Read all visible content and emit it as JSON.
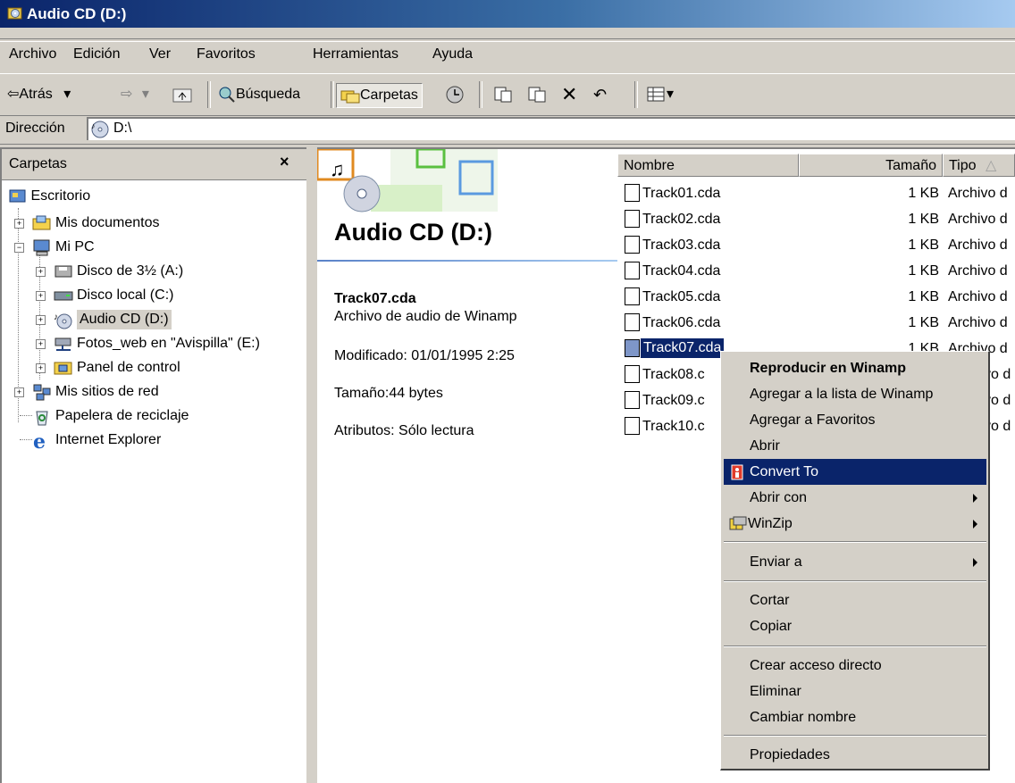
{
  "window": {
    "title": "Audio CD (D:)"
  },
  "menu": [
    "Archivo",
    "Edición",
    "Ver",
    "Favoritos",
    "Herramientas",
    "Ayuda"
  ],
  "toolbar": {
    "back": "Atrás",
    "search": "Búsqueda",
    "folders": "Carpetas"
  },
  "address": {
    "label": "Dirección",
    "value": "D:\\"
  },
  "folders_pane": {
    "title": "Carpetas",
    "items": [
      {
        "label": "Escritorio",
        "icon": "desktop-icon"
      },
      {
        "label": "Mis documentos",
        "icon": "documents-folder-icon"
      },
      {
        "label": "Mi PC",
        "icon": "computer-icon"
      },
      {
        "label": "Disco de 3½ (A:)",
        "icon": "floppy-icon"
      },
      {
        "label": "Disco local (C:)",
        "icon": "hard-drive-icon"
      },
      {
        "label": "Audio CD (D:)",
        "icon": "audio-cd-icon"
      },
      {
        "label": "Fotos_web en \"Avispilla\" (E:)",
        "icon": "network-drive-icon"
      },
      {
        "label": "Panel de control",
        "icon": "control-panel-icon"
      },
      {
        "label": "Mis sitios de red",
        "icon": "network-places-icon"
      },
      {
        "label": "Papelera de reciclaje",
        "icon": "recycle-bin-icon"
      },
      {
        "label": "Internet Explorer",
        "icon": "internet-explorer-icon"
      }
    ]
  },
  "details": {
    "title": "Audio CD (D:)",
    "file_name": "Track07.cda",
    "file_type": "Archivo de audio de Winamp",
    "modified": "Modificado: 01/01/1995 2:25",
    "size": "Tamaño:44 bytes",
    "attributes": "Atributos: Sólo lectura"
  },
  "list": {
    "columns": [
      "Nombre",
      "Tamaño",
      "Tipo"
    ],
    "rows": [
      {
        "name": "Track01.cda",
        "size": "1 KB",
        "type": "Archivo d"
      },
      {
        "name": "Track02.cda",
        "size": "1 KB",
        "type": "Archivo d"
      },
      {
        "name": "Track03.cda",
        "size": "1 KB",
        "type": "Archivo d"
      },
      {
        "name": "Track04.cda",
        "size": "1 KB",
        "type": "Archivo d"
      },
      {
        "name": "Track05.cda",
        "size": "1 KB",
        "type": "Archivo d"
      },
      {
        "name": "Track06.cda",
        "size": "1 KB",
        "type": "Archivo d"
      },
      {
        "name": "Track07.cda",
        "size": "1 KB",
        "type": "Archivo d"
      },
      {
        "name": "Track08.c",
        "size": "",
        "type": "vo d"
      },
      {
        "name": "Track09.c",
        "size": "",
        "type": "vo d"
      },
      {
        "name": "Track10.c",
        "size": "",
        "type": "vo d"
      }
    ]
  },
  "context_menu": {
    "items": [
      "Reproducir en Winamp",
      "Agregar a la lista de Winamp",
      "Agregar a Favoritos",
      "Abrir",
      "Convert To",
      "Abrir con",
      "WinZip",
      "Enviar a",
      "Cortar",
      "Copiar",
      "Crear acceso directo",
      "Eliminar",
      "Cambiar nombre",
      "Propiedades"
    ],
    "highlighted": "Convert To"
  }
}
